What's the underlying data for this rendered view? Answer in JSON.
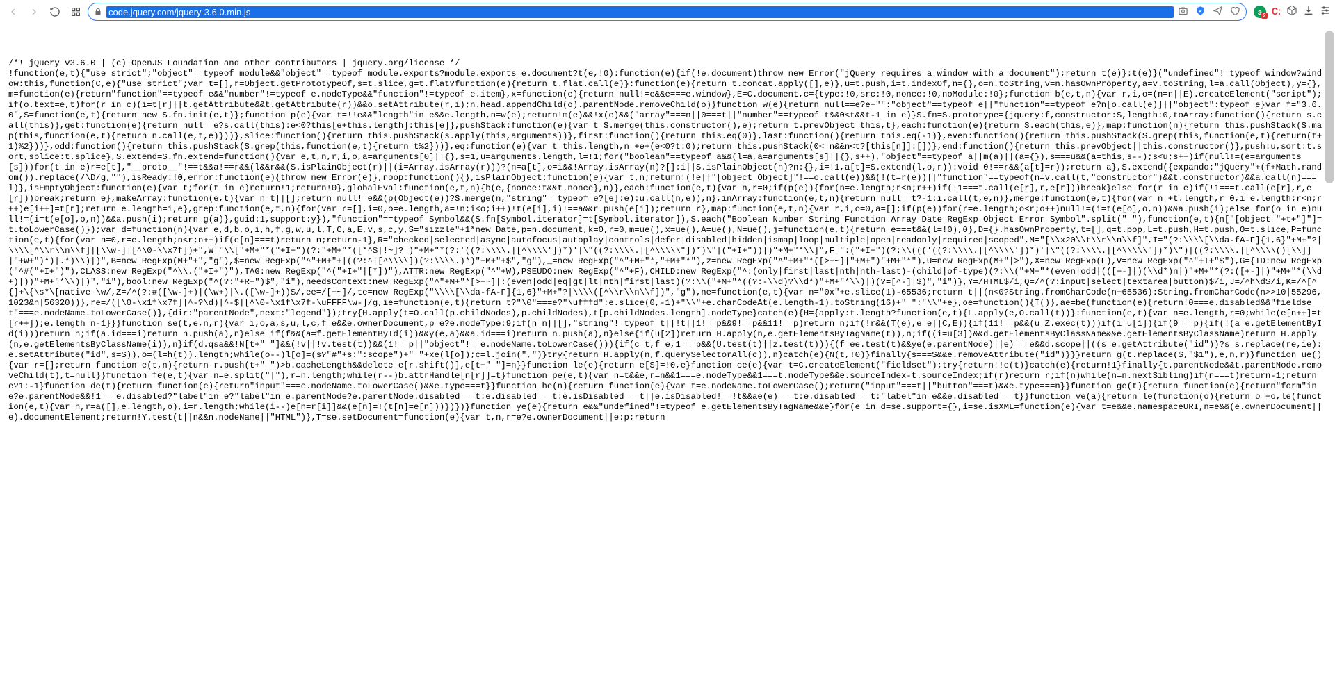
{
  "toolbar": {
    "url": "code.jquery.com/jquery-3.6.0.min.js",
    "ext_a_label": "a",
    "ext_a_badge": "2",
    "ext_c_label": "C:",
    "ext_c_badge": " "
  },
  "source": {
    "text": "/*! jQuery v3.6.0 | (c) OpenJS Foundation and other contributors | jquery.org/license */\n!function(e,t){\"use strict\";\"object\"==typeof module&&\"object\"==typeof module.exports?module.exports=e.document?t(e,!0):function(e){if(!e.document)throw new Error(\"jQuery requires a window with a document\");return t(e)}:t(e)}(\"undefined\"!=typeof window?window:this,function(C,e){\"use strict\";var t=[],r=Object.getPrototypeOf,s=t.slice,g=t.flat?function(e){return t.flat.call(e)}:function(e){return t.concat.apply([],e)},u=t.push,i=t.indexOf,n={},o=n.toString,v=n.hasOwnProperty,a=v.toString,l=a.call(Object),y={},m=function(e){return\"function\"==typeof e&&\"number\"!=typeof e.nodeType&&\"function\"!=typeof e.item},x=function(e){return null!=e&&e===e.window},E=C.document,c={type:!0,src:!0,nonce:!0,noModule:!0};function b(e,t,n){var r,i,o=(n=n||E).createElement(\"script\");if(o.text=e,t)for(r in c)(i=t[r]||t.getAttribute&&t.getAttribute(r))&&o.setAttribute(r,i);n.head.appendChild(o).parentNode.removeChild(o)}function w(e){return null==e?e+\"\":\"object\"==typeof e||\"function\"==typeof e?n[o.call(e)]||\"object\":typeof e}var f=\"3.6.0\",S=function(e,t){return new S.fn.init(e,t)};function p(e){var t=!!e&&\"length\"in e&&e.length,n=w(e);return!m(e)&&!x(e)&&(\"array\"===n||0===t||\"number\"==typeof t&&0<t&&t-1 in e)}S.fn=S.prototype={jquery:f,constructor:S,length:0,toArray:function(){return s.call(this)},get:function(e){return null==e?s.call(this):e<0?this[e+this.length]:this[e]},pushStack:function(e){var t=S.merge(this.constructor(),e);return t.prevObject=this,t},each:function(e){return S.each(this,e)},map:function(n){return this.pushStack(S.map(this,function(e,t){return n.call(e,t,e)}))},slice:function(){return this.pushStack(s.apply(this,arguments))},first:function(){return this.eq(0)},last:function(){return this.eq(-1)},even:function(){return this.pushStack(S.grep(this,function(e,t){return(t+1)%2}))},odd:function(){return this.pushStack(S.grep(this,function(e,t){return t%2}))},eq:function(e){var t=this.length,n=+e+(e<0?t:0);return this.pushStack(0<=n&&n<t?[this[n]]:[])},end:function(){return this.prevObject||this.constructor()},push:u,sort:t.sort,splice:t.splice},S.extend=S.fn.extend=function(){var e,t,n,r,i,o,a=arguments[0]||{},s=1,u=arguments.length,l=!1;for(\"boolean\"==typeof a&&(l=a,a=arguments[s]||{},s++),\"object\"==typeof a||m(a)||(a={}),s===u&&(a=this,s--);s<u;s++)if(null!=(e=arguments[s]))for(t in e)r=e[t],\"__proto__\"!==t&&a!==r&&(l&&r&&(S.isPlainObject(r)||(i=Array.isArray(r)))?(n=a[t],o=i&&!Array.isArray(n)?[]:i||S.isPlainObject(n)?n:{},i=!1,a[t]=S.extend(l,o,r)):void 0!==r&&(a[t]=r));return a},S.extend({expando:\"jQuery\"+(f+Math.random()).replace(/\\D/g,\"\"),isReady:!0,error:function(e){throw new Error(e)},noop:function(){},isPlainObject:function(e){var t,n;return!(!e||\"[object Object]\"!==o.call(e))&&(!(t=r(e))||\"function\"==typeof(n=v.call(t,\"constructor\")&&t.constructor)&&a.call(n)===l)},isEmptyObject:function(e){var t;for(t in e)return!1;return!0},globalEval:function(e,t,n){b(e,{nonce:t&&t.nonce},n)},each:function(e,t){var n,r=0;if(p(e)){for(n=e.length;r<n;r++)if(!1===t.call(e[r],r,e[r]))break}else for(r in e)if(!1===t.call(e[r],r,e[r]))break;return e},makeArray:function(e,t){var n=t||[];return null!=e&&(p(Object(e))?S.merge(n,\"string\"==typeof e?[e]:e):u.call(n,e)),n},inArray:function(e,t,n){return null==t?-1:i.call(t,e,n)},merge:function(e,t){for(var n=+t.length,r=0,i=e.length;r<n;r++)e[i++]=t[r];return e.length=i,e},grep:function(e,t,n){for(var r=[],i=0,o=e.length,a=!n;i<o;i++)!t(e[i],i)!==a&&r.push(e[i]);return r},map:function(e,t,n){var r,i,o=0,a=[];if(p(e))for(r=e.length;o<r;o++)null!=(i=t(e[o],o,n))&&a.push(i);else for(o in e)null!=(i=t(e[o],o,n))&&a.push(i);return g(a)},guid:1,support:y}),\"function\"==typeof Symbol&&(S.fn[Symbol.iterator]=t[Symbol.iterator]),S.each(\"Boolean Number String Function Array Date RegExp Object Error Symbol\".split(\" \"),function(e,t){n[\"[object \"+t+\"]\"]=t.toLowerCase()});var d=function(n){var e,d,b,o,i,h,f,g,w,u,l,T,C,a,E,v,s,c,y,S=\"sizzle\"+1*new Date,p=n.document,k=0,r=0,m=ue(),x=ue(),A=ue(),N=ue(),j=function(e,t){return e===t&&(l=!0),0},D={}.hasOwnProperty,t=[],q=t.pop,L=t.push,H=t.push,O=t.slice,P=function(e,t){for(var n=0,r=e.length;n<r;n++)if(e[n]===t)return n;return-1},R=\"checked|selected|async|autofocus|autoplay|controls|defer|disabled|hidden|ismap|loop|multiple|open|readonly|required|scoped\",M=\"[\\\\x20\\\\t\\\\r\\\\n\\\\f]\",I=\"(?:\\\\\\\\[\\\\da-fA-F]{1,6}\"+M+\"?|\\\\\\\\[^\\\\r\\\\n\\\\f]|[\\\\w-]|[^\\0-\\\\x7f])+\",W=\"\\\\[\"+M+\"*(\"+I+\")(?:\"+M+\"*([*^$|!~]?=)\"+M+\"*(?:'((?:\\\\\\\\.|[^\\\\\\\\'])*)'|\\\"((?:\\\\\\\\.|[^\\\\\\\\\\\"])*)\\\"|(\"+I+\"))|)\"+M+\"*\\\\]\",F=\":(\"+I+\")(?:\\\\((('((?:\\\\\\\\.|[^\\\\\\\\'])*)'|\\\"((?:\\\\\\\\.|[^\\\\\\\\\\\"])*)\\\")|((?:\\\\\\\\.|[^\\\\\\\\()[\\\\]]|\"+W+\")*)|.*)\\\\)|)\",B=new RegExp(M+\"+\",\"g\"),$=new RegExp(\"^\"+M+\"+|((?:^|[^\\\\\\\\])(?:\\\\\\\\.)*)\"+M+\"+$\",\"g\"),_=new RegExp(\"^\"+M+\"*,\"+M+\"*\"),z=new RegExp(\"^\"+M+\"*([>+~]|\"+M+\")\"+M+\"*\"),U=new RegExp(M+\"|>\"),X=new RegExp(F),V=new RegExp(\"^\"+I+\"$\"),G={ID:new RegExp(\"^#(\"+I+\")\"),CLASS:new RegExp(\"^\\\\.(\"+I+\")\"),TAG:new RegExp(\"^(\"+I+\"|[*])\"),ATTR:new RegExp(\"^\"+W),PSEUDO:new RegExp(\"^\"+F),CHILD:new RegExp(\"^:(only|first|last|nth|nth-last)-(child|of-type)(?:\\\\(\"+M+\"*(even|odd|(([+-]|)(\\\\d*)n|)\"+M+\"*(?:([+-]|)\"+M+\"*(\\\\d+)|))\"+M+\"*\\\\)|)\",\"i\"),bool:new RegExp(\"^(?:\"+R+\")$\",\"i\"),needsContext:new RegExp(\"^\"+M+\"*[>+~]|:(even|odd|eq|gt|lt|nth|first|last)(?:\\\\(\"+M+\"*((?:-\\\\d)?\\\\d*)\"+M+\"*\\\\)|)(?=[^-]|$)\",\"i\")},Y=/HTML$/i,Q=/^(?:input|select|textarea|button)$/i,J=/^h\\d$/i,K=/^[^{]+\\{\\s*\\[native \\w/,Z=/^(?:#([\\w-]+)|(\\w+)|\\.([\\w-]+))$/,ee=/[+~]/,te=new RegExp(\"\\\\\\\\[\\\\da-fA-F]{1,6}\"+M+\"?|\\\\\\\\([^\\\\r\\\\n\\\\f])\",\"g\"),ne=function(e,t){var n=\"0x\"+e.slice(1)-65536;return t||(n<0?String.fromCharCode(n+65536):String.fromCharCode(n>>10|55296,1023&n|56320))},re=/([\\0-\\x1f\\x7f]|^-?\\d)|^-$|[^\\0-\\x1f\\x7f-\\uFFFF\\w-]/g,ie=function(e,t){return t?\"\\0\"===e?\"\\ufffd\":e.slice(0,-1)+\"\\\\\"+e.charCodeAt(e.length-1).toString(16)+\" \":\"\\\\\"+e},oe=function(){T()},ae=be(function(e){return!0===e.disabled&&\"fieldset\"===e.nodeName.toLowerCase()},{dir:\"parentNode\",next:\"legend\"});try{H.apply(t=O.call(p.childNodes),p.childNodes),t[p.childNodes.length].nodeType}catch(e){H={apply:t.length?function(e,t){L.apply(e,O.call(t))}:function(e,t){var n=e.length,r=0;while(e[n++]=t[r++]);e.length=n-1}}}function se(t,e,n,r){var i,o,a,s,u,l,c,f=e&&e.ownerDocument,p=e?e.nodeType:9;if(n=n||[],\"string\"!=typeof t||!t||1!==p&&9!==p&&11!==p)return n;if(!r&&(T(e),e=e||C,E)){if(11!==p&&(u=Z.exec(t)))if(i=u[1]){if(9===p){if(!(a=e.getElementById(i)))return n;if(a.id===i)return n.push(a),n}else if(f&&(a=f.getElementById(i))&&y(e,a)&&a.id===i)return n.push(a),n}else{if(u[2])return H.apply(n,e.getElementsByTagName(t)),n;if((i=u[3])&&d.getElementsByClassName&&e.getElementsByClassName)return H.apply(n,e.getElementsByClassName(i)),n}if(d.qsa&&!N[t+\" \"]&&(!v||!v.test(t))&&(1!==p||\"object\"!==e.nodeName.toLowerCase())){if(c=t,f=e,1===p&&(U.test(t)||z.test(t))){(f=ee.test(t)&&ye(e.parentNode)||e)===e&&d.scope||((s=e.getAttribute(\"id\"))?s=s.replace(re,ie):e.setAttribute(\"id\",s=S)),o=(l=h(t)).length;while(o--)l[o]=(s?\"#\"+s:\":scope\")+\" \"+xe(l[o]);c=l.join(\",\")}try{return H.apply(n,f.querySelectorAll(c)),n}catch(e){N(t,!0)}finally{s===S&&e.removeAttribute(\"id\")}}}return g(t.replace($,\"$1\"),e,n,r)}function ue(){var r=[];return function e(t,n){return r.push(t+\" \")>b.cacheLength&&delete e[r.shift()],e[t+\" \"]=n}}function le(e){return e[S]=!0,e}function ce(e){var t=C.createElement(\"fieldset\");try{return!!e(t)}catch(e){return!1}finally{t.parentNode&&t.parentNode.removeChild(t),t=null}}function fe(e,t){var n=e.split(\"|\"),r=n.length;while(r--)b.attrHandle[n[r]]=t}function pe(e,t){var n=t&&e,r=n&&1===e.nodeType&&1===t.nodeType&&e.sourceIndex-t.sourceIndex;if(r)return r;if(n)while(n=n.nextSibling)if(n===t)return-1;return e?1:-1}function de(t){return function(e){return\"input\"===e.nodeName.toLowerCase()&&e.type===t}}function he(n){return function(e){var t=e.nodeName.toLowerCase();return(\"input\"===t||\"button\"===t)&&e.type===n}}function ge(t){return function(e){return\"form\"in e?e.parentNode&&!1===e.disabled?\"label\"in e?\"label\"in e.parentNode?e.parentNode.disabled===t:e.disabled===t:e.isDisabled===t||e.isDisabled!==!t&&ae(e)===t:e.disabled===t:\"label\"in e&&e.disabled===t}}function ve(a){return le(function(o){return o=+o,le(function(e,t){var n,r=a([],e.length,o),i=r.length;while(i--)e[n=r[i]]&&(e[n]=!(t[n]=e[n]))})})}function ye(e){return e&&\"undefined\"!=typeof e.getElementsByTagName&&e}for(e in d=se.support={},i=se.isXML=function(e){var t=e&&e.namespaceURI,n=e&&(e.ownerDocument||e).documentElement;return!Y.test(t||n&&n.nodeName||\"HTML\")},T=se.setDocument=function(e){var t,n,r=e?e.ownerDocument||e:p;return"
  }
}
